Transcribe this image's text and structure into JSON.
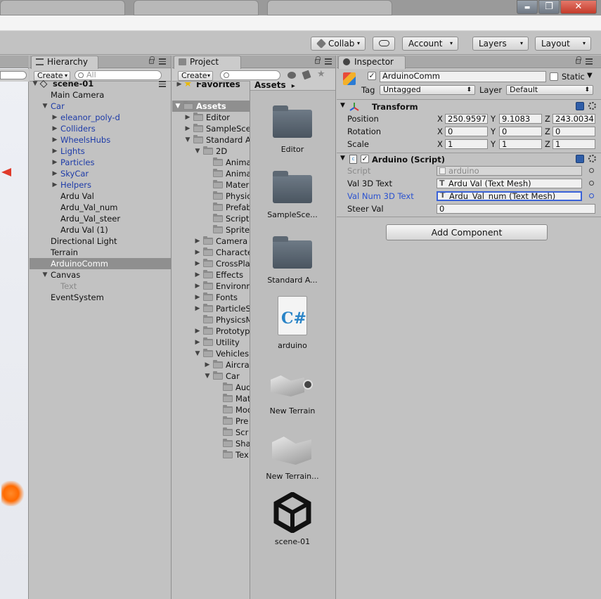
{
  "window": {
    "minimize_glyph": "▬",
    "restore_glyph": "❐",
    "close_glyph": "✕"
  },
  "toolbar": {
    "collab_label": "Collab",
    "account_label": "Account",
    "layers_label": "Layers",
    "layout_label": "Layout",
    "dropdown_arrow": "▾"
  },
  "hierarchy": {
    "tab_label": "Hierarchy",
    "create_label": "Create",
    "search_placeholder": "All",
    "scene_name": "scene-01",
    "items": [
      {
        "label": "Main Camera"
      },
      {
        "label": "Car"
      },
      {
        "label": "eleanor_poly-d"
      },
      {
        "label": "Colliders"
      },
      {
        "label": "WheelsHubs"
      },
      {
        "label": "Lights"
      },
      {
        "label": "Particles"
      },
      {
        "label": "SkyCar"
      },
      {
        "label": "Helpers"
      },
      {
        "label": "Ardu Val"
      },
      {
        "label": "Ardu_Val_num"
      },
      {
        "label": "Ardu_Val_steer"
      },
      {
        "label": "Ardu Val (1)"
      },
      {
        "label": "Directional Light"
      },
      {
        "label": "Terrain"
      },
      {
        "label": "ArduinoComm"
      },
      {
        "label": "Canvas"
      },
      {
        "label": "Text"
      },
      {
        "label": "EventSystem"
      }
    ]
  },
  "project": {
    "tab_label": "Project",
    "create_label": "Create",
    "favorites_label": "Favorites",
    "assets_breadcrumb": "Assets",
    "breadcrumb_arrow": "▸",
    "tree": [
      {
        "label": "Assets"
      },
      {
        "label": "Editor"
      },
      {
        "label": "SampleSce"
      },
      {
        "label": "Standard A"
      },
      {
        "label": "2D"
      },
      {
        "label": "Anima"
      },
      {
        "label": "Anima"
      },
      {
        "label": "Mater"
      },
      {
        "label": "Physic"
      },
      {
        "label": "Prefab"
      },
      {
        "label": "Script"
      },
      {
        "label": "Sprite"
      },
      {
        "label": "Camera"
      },
      {
        "label": "Characte"
      },
      {
        "label": "CrossPla"
      },
      {
        "label": "Effects"
      },
      {
        "label": "Environm"
      },
      {
        "label": "Fonts"
      },
      {
        "label": "ParticleS"
      },
      {
        "label": "PhysicsM"
      },
      {
        "label": "Prototyp"
      },
      {
        "label": "Utility"
      },
      {
        "label": "Vehicles"
      },
      {
        "label": "Aircra"
      },
      {
        "label": "Car"
      },
      {
        "label": "Aud"
      },
      {
        "label": "Mat"
      },
      {
        "label": "Mod"
      },
      {
        "label": "Pre"
      },
      {
        "label": "Scr"
      },
      {
        "label": "Sha"
      },
      {
        "label": "Tex"
      }
    ],
    "assets": [
      {
        "label": "Editor"
      },
      {
        "label": "SampleSce..."
      },
      {
        "label": "Standard A..."
      },
      {
        "label": "arduino",
        "glyph": "C#"
      },
      {
        "label": "New Terrain"
      },
      {
        "label": "New Terrain..."
      },
      {
        "label": "scene-01"
      }
    ]
  },
  "inspector": {
    "tab_label": "Inspector",
    "object_name": "ArduinoComm",
    "static_label": "Static",
    "tag_label": "Tag",
    "tag_value": "Untagged",
    "layer_label": "Layer",
    "layer_value": "Default",
    "check_mark": "✓",
    "transform": {
      "title": "Transform",
      "position_label": "Position",
      "rotation_label": "Rotation",
      "scale_label": "Scale",
      "x_label": "X",
      "y_label": "Y",
      "z_label": "Z",
      "position": {
        "x": "250.9597",
        "y": "9.1083",
        "z": "243.0034"
      },
      "rotation": {
        "x": "0",
        "y": "0",
        "z": "0"
      },
      "scale": {
        "x": "1",
        "y": "1",
        "z": "1"
      }
    },
    "script": {
      "title": "Arduino (Script)",
      "script_label": "Script",
      "script_value": "arduino",
      "val3d_label": "Val 3D Text",
      "val3d_value": "Ardu Val (Text Mesh)",
      "valnum_label": "Val Num 3D Text",
      "valnum_value": "Ardu_Val_num (Text Mesh)",
      "steer_label": "Steer Val",
      "steer_value": "0"
    },
    "add_component_label": "Add Component"
  }
}
